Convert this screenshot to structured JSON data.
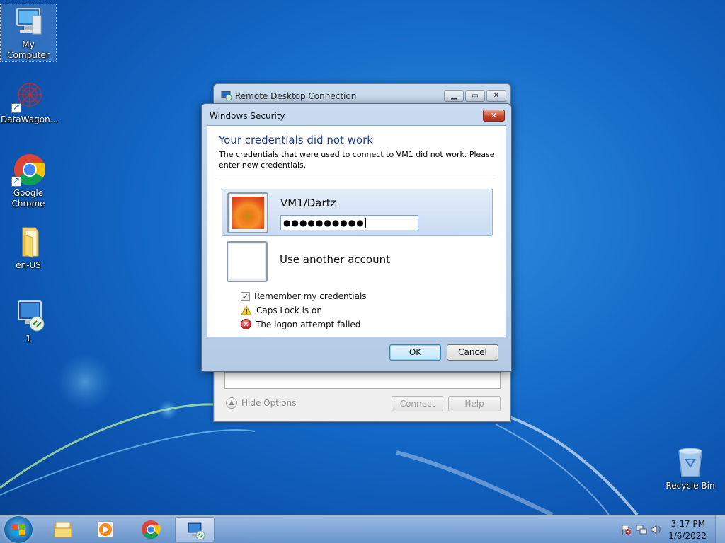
{
  "desktop": {
    "icons": [
      {
        "label": "My Computer",
        "icon": "computer-icon"
      },
      {
        "label": "DataWagon...",
        "icon": "datawagon-icon"
      },
      {
        "label": "Google Chrome",
        "icon": "chrome-icon"
      },
      {
        "label": "en-US",
        "icon": "folder-icon"
      },
      {
        "label": "1",
        "icon": "remote-desktop-file-icon"
      },
      {
        "label": "Recycle Bin",
        "icon": "recycle-bin-icon"
      }
    ]
  },
  "rdc_window": {
    "title": "Remote Desktop Connection",
    "hide_options": "Hide Options",
    "connect": "Connect",
    "help": "Help",
    "caption": {
      "minimize": "▁",
      "maximize": "▭",
      "close": "✕"
    }
  },
  "security_dialog": {
    "title": "Windows Security",
    "close_glyph": "✕",
    "heading": "Your credentials did not work",
    "description": "The credentials that were used to connect to VM1 did not work. Please enter new credentials.",
    "user": "VM1/Dartz",
    "password_mask": "●●●●●●●●●●",
    "other_account": "Use another account",
    "remember": "Remember my credentials",
    "remember_checked": true,
    "remember_glyph": "✓",
    "caps_lock": "Caps Lock is on",
    "logon_failed": "The logon attempt failed",
    "error_glyph": "✕",
    "ok": "OK",
    "cancel": "Cancel"
  },
  "taskbar": {
    "items": [
      {
        "icon": "file-explorer-icon",
        "active": false
      },
      {
        "icon": "media-player-icon",
        "active": false
      },
      {
        "icon": "chrome-icon",
        "active": false
      },
      {
        "icon": "remote-desktop-icon",
        "active": true
      }
    ],
    "time": "3:17 PM",
    "date": "1/6/2022"
  },
  "colors": {
    "heading": "#1e3e8a",
    "desktop": "#1469c7",
    "close_red": "#c7472d"
  }
}
